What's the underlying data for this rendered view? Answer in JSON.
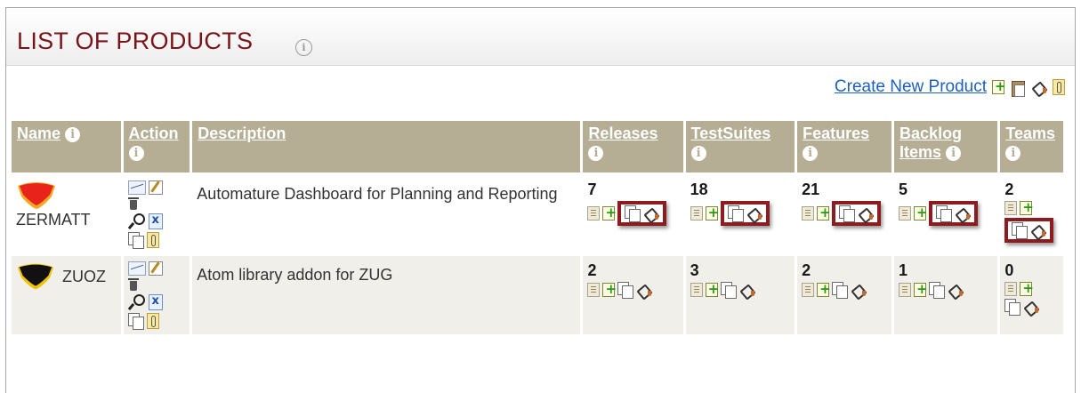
{
  "page": {
    "title": "LIST OF PRODUCTS",
    "create_link": "Create New Product"
  },
  "columns": [
    "Name",
    "Action",
    "Description",
    "Releases",
    "TestSuites",
    "Features",
    "Backlog Items",
    "Teams"
  ],
  "products": [
    {
      "name": "ZERMATT",
      "description": "Automature Dashboard for Planning and Reporting",
      "releases": "7",
      "testsuites": "18",
      "features": "21",
      "backlog_items": "5",
      "teams": "2",
      "logo_colors": [
        "#e8231b",
        "#f5a623"
      ]
    },
    {
      "name": "ZUOZ",
      "description": "Atom library addon for ZUG",
      "releases": "2",
      "testsuites": "3",
      "features": "2",
      "backlog_items": "1",
      "teams": "0",
      "logo_colors": [
        "#111111",
        "#f5c400"
      ]
    }
  ],
  "icons": {
    "info": "info-icon",
    "list": "list-icon",
    "add": "add-icon",
    "copy": "copy-icon",
    "paint": "paint-bucket-icon",
    "attachment": "attachment-icon",
    "clipboard": "clipboard-icon",
    "chart": "chart-icon",
    "edit": "edit-icon",
    "delete": "trash-icon",
    "search": "search-icon",
    "export": "excel-icon"
  },
  "colors": {
    "title": "#7a1418",
    "header_bg": "#b6ae94",
    "link": "#1f5fbf",
    "highlight": "#8c1c20"
  }
}
